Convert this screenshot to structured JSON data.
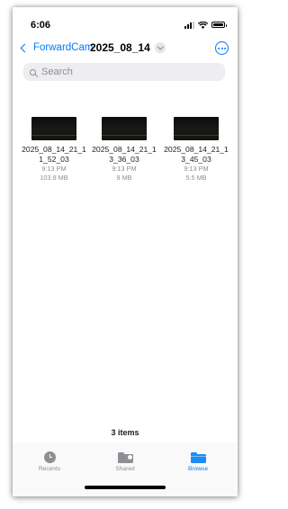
{
  "status_bar": {
    "time": "6:06"
  },
  "nav": {
    "back_label": "ForwardCam",
    "title": "2025_08_14"
  },
  "search": {
    "placeholder": "Search"
  },
  "files": [
    {
      "name": "2025_08_14_21_11_52_03",
      "time": "9:13 PM",
      "size": "103.8 MB"
    },
    {
      "name": "2025_08_14_21_13_36_03",
      "time": "9:13 PM",
      "size": "9 MB"
    },
    {
      "name": "2025_08_14_21_13_45_03",
      "time": "9:13 PM",
      "size": "5.5 MB"
    }
  ],
  "footer": {
    "items_count": "3 items"
  },
  "tabs": [
    {
      "label": "Recents",
      "icon": "clock-icon",
      "active": false
    },
    {
      "label": "Shared",
      "icon": "shared-folder-icon",
      "active": false
    },
    {
      "label": "Browse",
      "icon": "folder-icon",
      "active": true
    }
  ],
  "colors": {
    "accent": "#007aff",
    "secondary_text": "#8e8e93",
    "search_bg": "#eeeef0"
  }
}
